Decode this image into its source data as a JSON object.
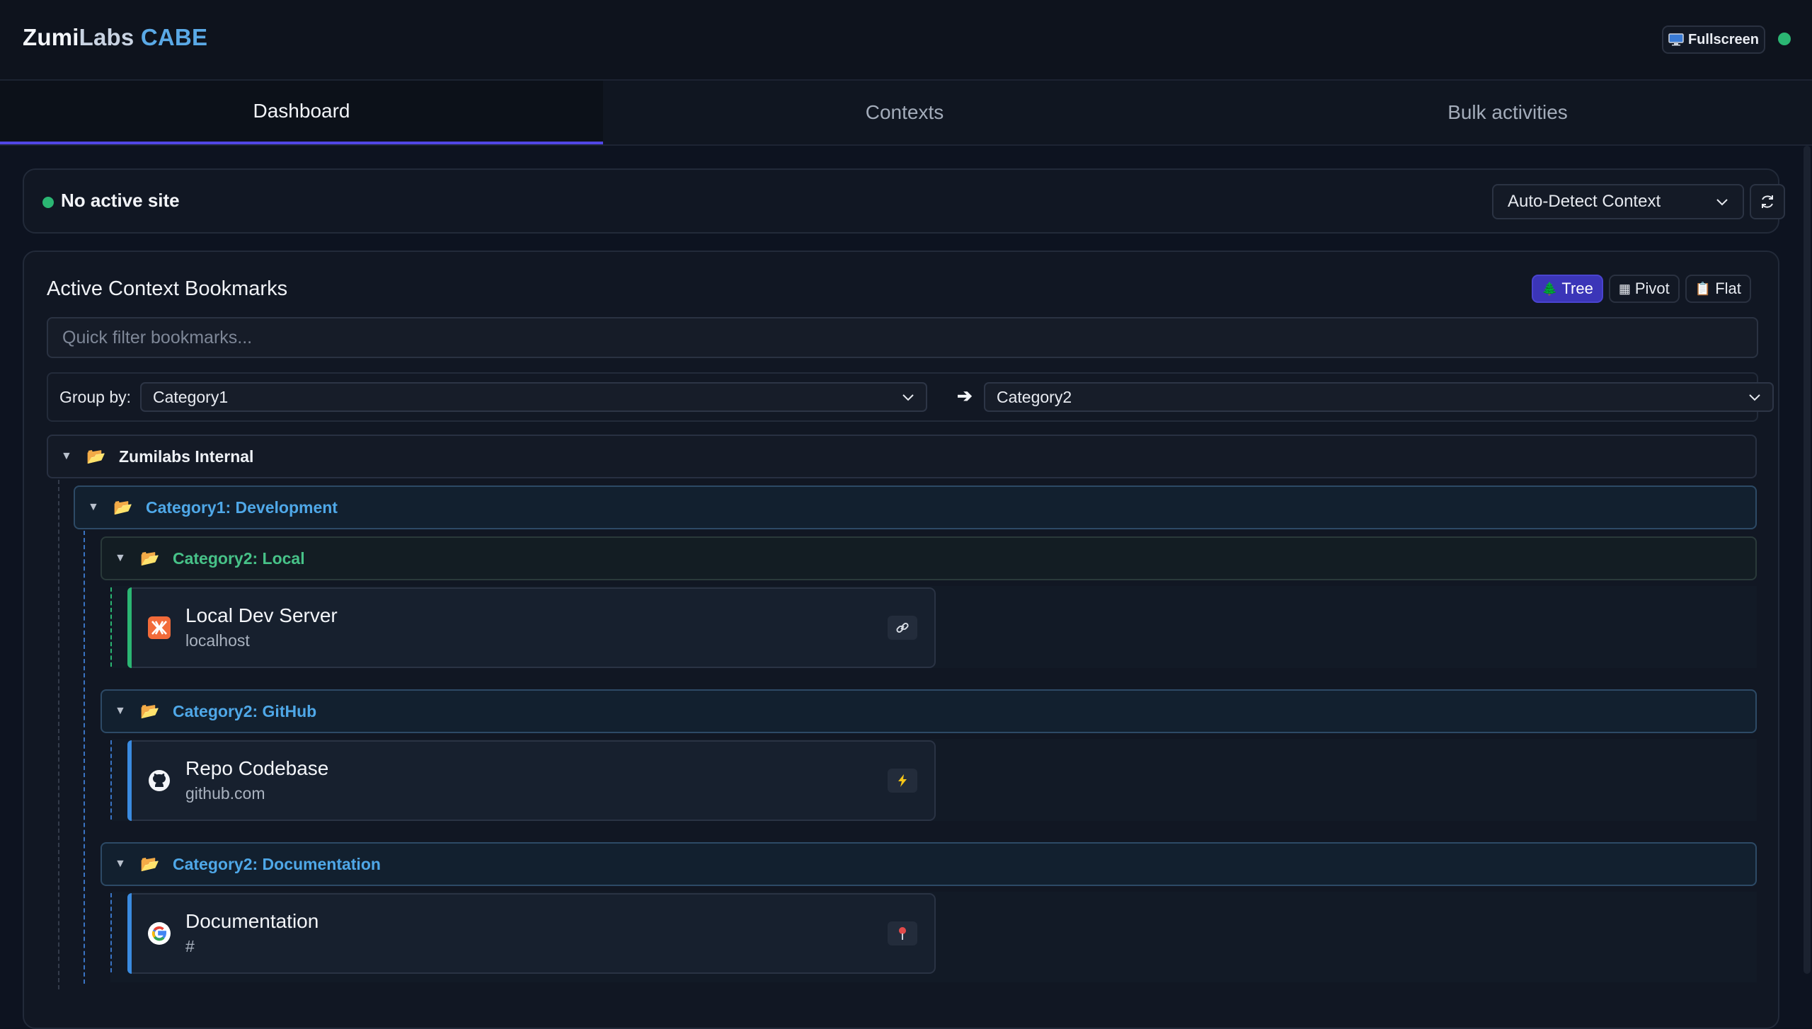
{
  "app": {
    "brand_part1": "Zumi",
    "brand_part2": "Labs",
    "brand_part3": "CABE",
    "fullscreen_label": "Fullscreen",
    "status_color": "#2bb673"
  },
  "tabs": [
    {
      "label": "Dashboard",
      "active": true
    },
    {
      "label": "Contexts",
      "active": false
    },
    {
      "label": "Bulk activities",
      "active": false
    }
  ],
  "site": {
    "status_text": "No active site",
    "context_select_value": "Auto-Detect Context"
  },
  "bookmarks": {
    "title": "Active Context Bookmarks",
    "views": [
      {
        "icon": "tree-icon",
        "label": "Tree",
        "active": true
      },
      {
        "icon": "pivot-icon",
        "label": "Pivot",
        "active": false
      },
      {
        "icon": "clipboard-icon",
        "label": "Flat",
        "active": false
      }
    ],
    "filter_placeholder": "Quick filter bookmarks...",
    "group_by_label": "Group by:",
    "group_by_primary": "Category1",
    "group_by_secondary": "Category2",
    "tree": {
      "root_label": "Zumilabs Internal",
      "category1_label": "Category1: Development",
      "groups": [
        {
          "label": "Category2: Local",
          "item": {
            "title": "Local Dev Server",
            "url": "localhost",
            "icon": "xampp-icon",
            "action_icon": "link-icon"
          }
        },
        {
          "label": "Category2: GitHub",
          "item": {
            "title": "Repo Codebase",
            "url": "github.com",
            "icon": "github-icon",
            "action_icon": "lightning-icon"
          }
        },
        {
          "label": "Category2: Documentation",
          "item": {
            "title": "Documentation",
            "url": "#",
            "icon": "google-icon",
            "action_icon": "pin-icon"
          }
        }
      ]
    }
  },
  "colors": {
    "accent": "#5046e5",
    "link_blue": "#4fa8e8",
    "success_green": "#47c288"
  }
}
